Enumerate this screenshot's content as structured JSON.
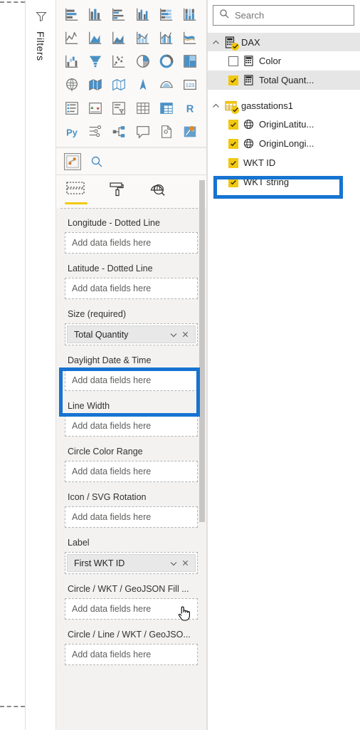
{
  "filters_pane": {
    "label": "Filters",
    "icon": "filter-funnel-icon"
  },
  "visualizations": {
    "gallery_icons": [
      "stacked-bar-chart-icon",
      "stacked-column-chart-icon",
      "clustered-bar-chart-icon",
      "clustered-column-chart-icon",
      "100-percent-stacked-bar-chart-icon",
      "100-percent-stacked-column-chart-icon",
      "line-chart-icon",
      "area-chart-icon",
      "stacked-area-chart-icon",
      "line-and-stacked-column-chart-icon",
      "line-and-clustered-column-chart-icon",
      "ribbon-chart-icon",
      "waterfall-chart-icon",
      "funnel-chart-icon",
      "scatter-chart-icon",
      "pie-chart-icon",
      "donut-chart-icon",
      "treemap-icon",
      "map-icon",
      "filled-map-icon",
      "shape-map-icon",
      "arcgis-map-icon",
      "azure-map-icon",
      "card-icon",
      "multi-row-card-icon",
      "kpi-icon",
      "slicer-icon",
      "table-icon",
      "matrix-icon",
      "r-script-visual-icon",
      "python-visual-icon",
      "key-influencers-icon",
      "decomposition-tree-icon",
      "q-and-a-icon",
      "paginated-report-icon",
      "power-apps-icon",
      "get-more-visuals-icon",
      "more-options-icon"
    ],
    "custom_visual_row": {
      "visual_icon": "icon-map-custom-visual",
      "search_icon": "search-icon"
    },
    "tabs": [
      {
        "name": "build-tab",
        "icon": "build-fields-icon",
        "active": true
      },
      {
        "name": "format-tab",
        "icon": "paint-roller-icon",
        "active": false
      },
      {
        "name": "analytics-tab",
        "icon": "analytics-magnifier-icon",
        "active": false
      }
    ]
  },
  "field_wells": {
    "placeholder": "Add data fields here",
    "wells": [
      {
        "title": "Longitude - Dotted Line",
        "value": null
      },
      {
        "title": "Latitude - Dotted Line",
        "value": null
      },
      {
        "title": "Size (required)",
        "value": "Total Quantity"
      },
      {
        "title": "Daylight Date & Time",
        "value": null
      },
      {
        "title": "Line Width",
        "value": null
      },
      {
        "title": "Circle Color Range",
        "value": null
      },
      {
        "title": "Icon / SVG Rotation",
        "value": null
      },
      {
        "title": "Label",
        "value": "First WKT ID",
        "highlighted": true
      },
      {
        "title": "Circle / WKT / GeoJSON Fill ...",
        "value": null
      },
      {
        "title": "Circle / Line / WKT / GeoJSO...",
        "value": null
      }
    ],
    "chip_icons": {
      "dropdown": "chevron-down-icon",
      "remove": "close-icon"
    }
  },
  "fields_pane": {
    "search": {
      "placeholder": "Search",
      "value": "",
      "icon": "search-icon"
    },
    "tables": [
      {
        "name": "DAX",
        "icon": "measure-table-icon",
        "expanded": true,
        "selected": true,
        "fields": [
          {
            "label": "Color",
            "icon": "measure-icon",
            "checked": false,
            "selected": false
          },
          {
            "label": "Total Quant...",
            "icon": "measure-icon",
            "checked": true,
            "selected": true
          }
        ]
      },
      {
        "name": "gasstations1",
        "icon": "table-icon",
        "expanded": true,
        "selected": false,
        "fields": [
          {
            "label": "OriginLatitu...",
            "icon": "globe-icon",
            "checked": true,
            "selected": false
          },
          {
            "label": "OriginLongi...",
            "icon": "globe-icon",
            "checked": true,
            "selected": false
          },
          {
            "label": "WKT ID",
            "icon": null,
            "checked": true,
            "selected": false,
            "highlighted": true
          },
          {
            "label": "WKT string",
            "icon": null,
            "checked": true,
            "selected": false
          }
        ]
      }
    ]
  },
  "annotations": {
    "highlight_color": "#1673d1",
    "accent_color": "#f2c811",
    "cursor": "hand-pointer-cursor"
  }
}
